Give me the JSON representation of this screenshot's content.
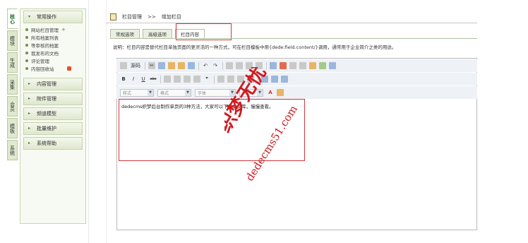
{
  "side_tabs": [
    "核心",
    "模块",
    "生成",
    "采集",
    "会员",
    "模板",
    "系统"
  ],
  "menu": {
    "groups": [
      {
        "label": "常用操作",
        "items": [
          "网站栏目管理",
          "所有档案列表",
          "等审核的档案",
          "我发布的文档",
          "评论管理",
          "内容回收站"
        ]
      },
      {
        "label": "内容管理"
      },
      {
        "label": "附件管理"
      },
      {
        "label": "频道模型"
      },
      {
        "label": "批量维护"
      },
      {
        "label": "系统帮助"
      }
    ]
  },
  "breadcrumb": {
    "section": "栏目管理",
    "sep": ">>",
    "current": "增加栏目"
  },
  "tabs": [
    "常规选项",
    "高级选项",
    "栏目内容"
  ],
  "note": "说明：栏目内容是替代栏目单独页面的更灵活的一种方式，可在栏目模板中用{dede:field.content/}调用，通常用于企业简介之类的用途。",
  "editor": {
    "toolbar1": [
      "源码",
      "剪切",
      "复制",
      "粘贴",
      "粘贴文本",
      "粘贴Word",
      "撤销",
      "重做",
      "查找",
      "替换",
      "全选",
      "清除格式",
      "图片",
      "Flash",
      "表格",
      "水平线",
      "表情",
      "特殊字符",
      "分页"
    ],
    "toolbar2": [
      "B",
      "I",
      "U",
      "abc",
      "编号",
      "项目",
      "减少缩进",
      "增加缩进",
      "引用",
      "左对齐",
      "居中",
      "右对齐",
      "两端",
      "链接",
      "取消链接",
      "锚点"
    ],
    "combos": [
      {
        "label": "样式"
      },
      {
        "label": "格式"
      },
      {
        "label": "字体"
      },
      {
        "label": "大小"
      }
    ],
    "content": "dedecms织梦后台制作单页的3种方法，大家可以下载本文库，慢慢查看。"
  },
  "watermark": {
    "line1": "织梦无忧",
    "line2": "dedecms51.com"
  }
}
